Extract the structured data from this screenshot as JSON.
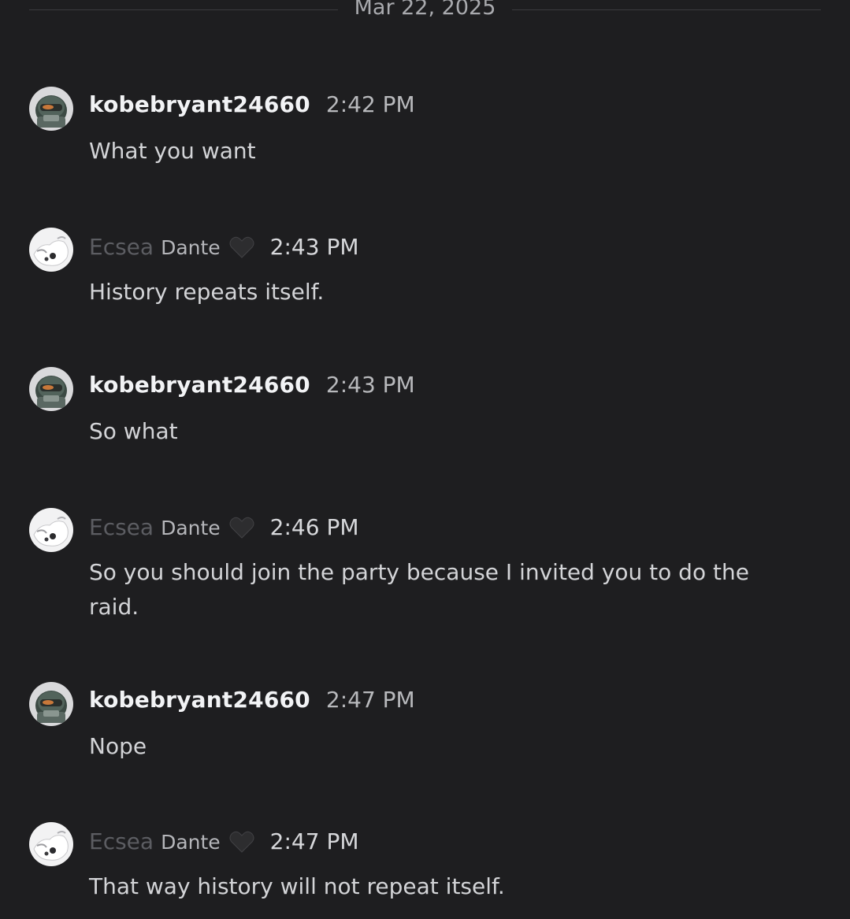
{
  "date_divider": "Mar 22, 2025",
  "messages": [
    {
      "author": "kobebryant24660",
      "timestamp": "2:42 PM",
      "text": "What you want",
      "avatar": "masked-soldier-avatar"
    },
    {
      "author_part1": "Ecsea",
      "author_part2": "Dante",
      "author_emoji": "black-heart-icon",
      "timestamp": "2:43 PM",
      "text": "History repeats itself.",
      "avatar": "white-creature-avatar"
    },
    {
      "author": "kobebryant24660",
      "timestamp": "2:43 PM",
      "text": "So what",
      "avatar": "masked-soldier-avatar"
    },
    {
      "author_part1": "Ecsea",
      "author_part2": "Dante",
      "author_emoji": "black-heart-icon",
      "timestamp": "2:46 PM",
      "text": "So you should join the party because I invited you to do the raid.",
      "avatar": "white-creature-avatar"
    },
    {
      "author": "kobebryant24660",
      "timestamp": "2:47 PM",
      "text": "Nope",
      "avatar": "masked-soldier-avatar"
    },
    {
      "author_part1": "Ecsea",
      "author_part2": "Dante",
      "author_emoji": "black-heart-icon",
      "timestamp": "2:47 PM",
      "text": "That way history will not repeat itself.",
      "avatar": "white-creature-avatar"
    }
  ],
  "colors": {
    "background": "#1e1e20",
    "username": "#f2f3f5",
    "display_name_dim": "#5c5d62",
    "timestamp": "#b8b9bc",
    "message_text": "#d3d4d7"
  }
}
